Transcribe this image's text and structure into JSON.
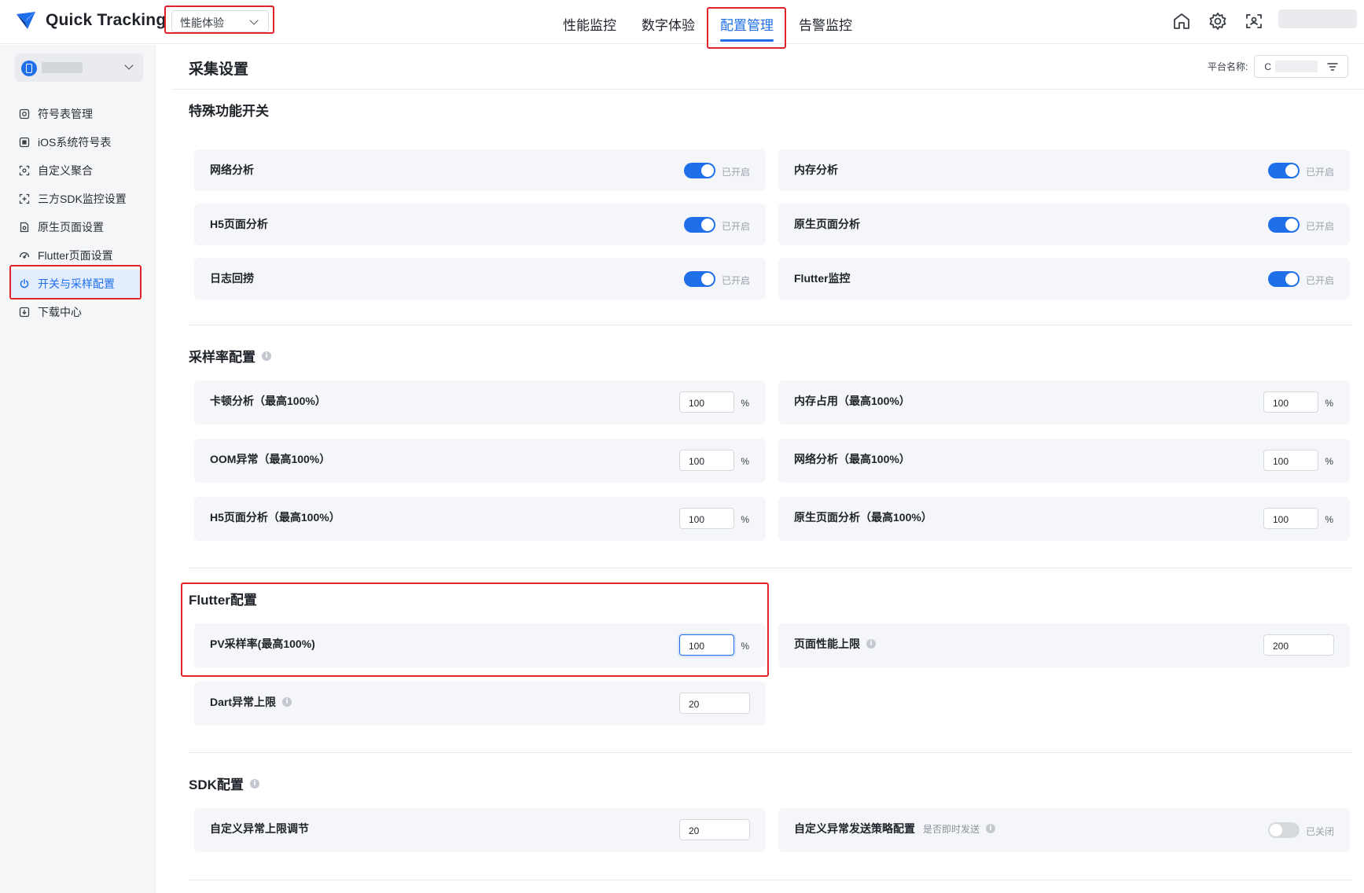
{
  "app": {
    "name": "Quick Tracking",
    "product_select": "性能体验"
  },
  "nav": [
    "性能监控",
    "数字体验",
    "配置管理",
    "告警监控"
  ],
  "nav_active": 2,
  "header_icons": [
    "home-icon",
    "gear-icon",
    "scan-icon"
  ],
  "sidebar": {
    "items": [
      {
        "label": "符号表管理",
        "icon": "symbol-icon"
      },
      {
        "label": "iOS系统符号表",
        "icon": "ios-icon"
      },
      {
        "label": "自定义聚合",
        "icon": "aggregate-icon"
      },
      {
        "label": "三方SDK监控设置",
        "icon": "sdk-icon"
      },
      {
        "label": "原生页面设置",
        "icon": "page-icon"
      },
      {
        "label": "Flutter页面设置",
        "icon": "flutter-icon"
      },
      {
        "label": "开关与采样配置",
        "icon": "power-icon"
      },
      {
        "label": "下载中心",
        "icon": "download-icon"
      }
    ],
    "active_index": 6
  },
  "page": {
    "title": "采集设置",
    "platform_label": "平台名称:",
    "platform_value": "C"
  },
  "special": {
    "title": "特殊功能开关",
    "on_text": "已开启",
    "items": [
      {
        "label": "网络分析",
        "on": true
      },
      {
        "label": "内存分析",
        "on": true
      },
      {
        "label": "H5页面分析",
        "on": true
      },
      {
        "label": "原生页面分析",
        "on": true
      },
      {
        "label": "日志回捞",
        "on": true
      },
      {
        "label": "Flutter监控",
        "on": true
      }
    ]
  },
  "sampling": {
    "title": "采样率配置",
    "unit": "%",
    "items": [
      {
        "label": "卡顿分析（最高100%）",
        "value": "100"
      },
      {
        "label": "内存占用（最高100%）",
        "value": "100"
      },
      {
        "label": "OOM异常（最高100%）",
        "value": "100"
      },
      {
        "label": "网络分析（最高100%）",
        "value": "100"
      },
      {
        "label": "H5页面分析（最高100%）",
        "value": "100"
      },
      {
        "label": "原生页面分析（最高100%）",
        "value": "100"
      }
    ]
  },
  "flutter": {
    "title": "Flutter配置",
    "pv_label": "PV采样率(最高100%)",
    "pv_value": "100",
    "page_limit_label": "页面性能上限",
    "page_limit_value": "200",
    "dart_label": "Dart异常上限",
    "dart_value": "20"
  },
  "sdk": {
    "title": "SDK配置",
    "custom_limit_label": "自定义异常上限调节",
    "custom_limit_value": "20",
    "strategy_label": "自定义异常发送策略配置",
    "strategy_hint": "是否即时发送",
    "strategy_on": false,
    "off_text": "已关闭"
  },
  "colors": {
    "accent": "#1f6feb",
    "highlight": "#e0222b"
  }
}
